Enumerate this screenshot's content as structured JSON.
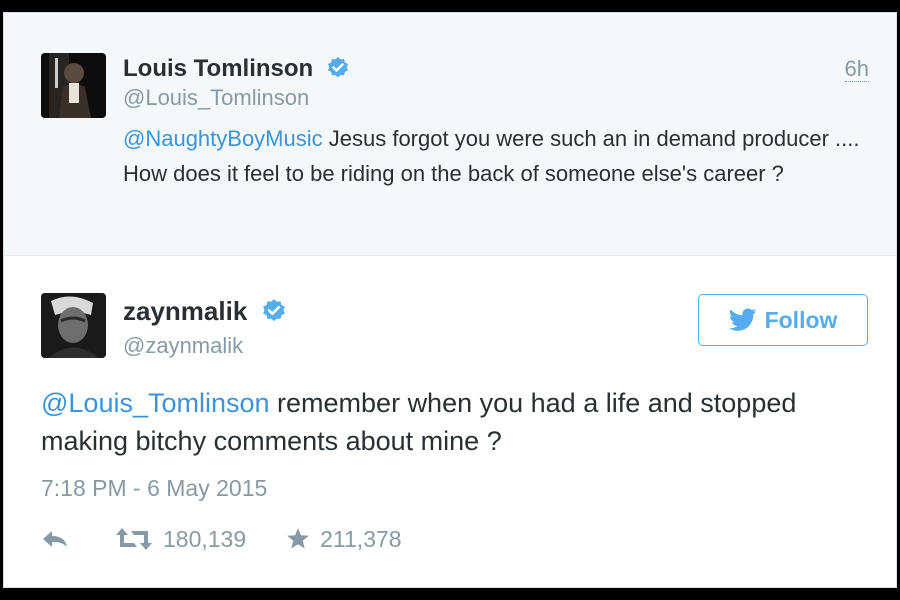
{
  "parent_tweet": {
    "display_name": "Louis Tomlinson",
    "handle": "@Louis_Tomlinson",
    "time_ago": "6h",
    "mention": "@NaughtyBoyMusic",
    "text": " Jesus forgot you were such an in demand producer .... How does it feel to be riding on the back of someone else's career ?"
  },
  "main_tweet": {
    "display_name": "zaynmalik",
    "handle": "@zaynmalik",
    "follow_label": "Follow",
    "mention": "@Louis_Tomlinson",
    "text": " remember when you had a life and stopped making bitchy comments about mine ?",
    "timestamp": "7:18 PM - 6 May 2015",
    "retweets": "180,139",
    "favorites": "211,378"
  },
  "colors": {
    "link": "#3b94d9",
    "follow_blue": "#55acee",
    "verified_blue": "#55acee",
    "muted": "#8899a6",
    "text": "#292f33",
    "parent_bg": "#f5f8fa"
  },
  "icons": [
    "verified-badge-icon",
    "twitter-bird-icon",
    "reply-icon",
    "retweet-icon",
    "favorite-star-icon"
  ]
}
